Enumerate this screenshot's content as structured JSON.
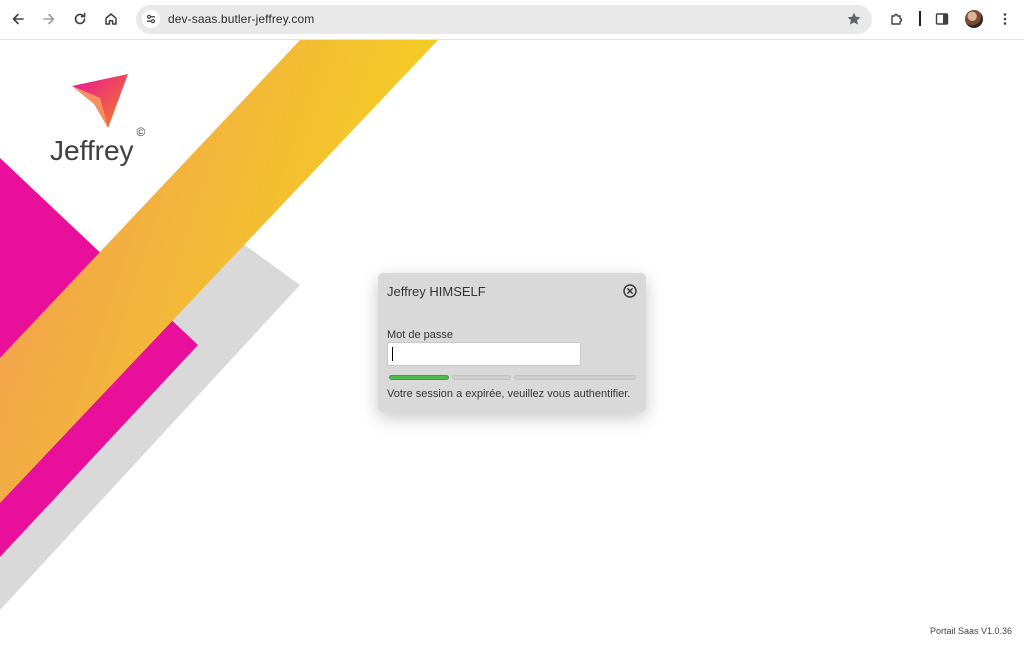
{
  "browser": {
    "url": "dev-saas.butler-jeffrey.com",
    "icons": {
      "back": "arrow-left-icon",
      "forward": "arrow-right-icon",
      "reload": "reload-icon",
      "home": "home-icon",
      "site_info": "tune-icon",
      "bookmark": "star-icon",
      "extensions": "puzzle-icon",
      "side_panel": "side-panel-icon",
      "profile": "avatar",
      "menu": "kebab-menu-icon"
    }
  },
  "brand": {
    "name": "Jeffrey",
    "mark": "©"
  },
  "dialog": {
    "title": "Jeffrey HIMSELF",
    "password_label": "Mot de passe",
    "password_value": "",
    "strength_level": 1,
    "strength_segments": 3,
    "message": "Votre session a expirée, veuillez vous authentifier."
  },
  "footer": {
    "version": "Portail Saas V1.0.36"
  },
  "colors": {
    "magenta": "#e8109a",
    "orange": "#f2a34a",
    "yellow": "#f3cd22",
    "gray_band": "#d9d9d9",
    "dialog_bg": "#d9d9d9",
    "strength_on": "#4cbb4c"
  }
}
